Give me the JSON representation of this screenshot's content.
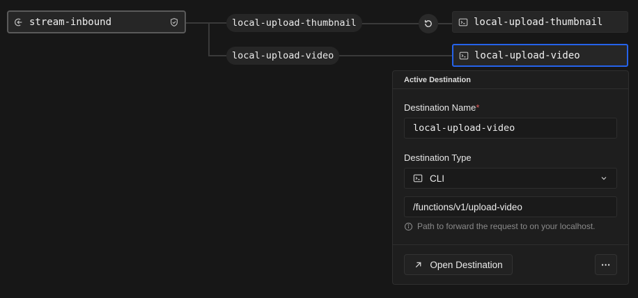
{
  "source": {
    "label": "stream-inbound",
    "icon": "inbound-icon",
    "badge_icon": "shield-check-icon"
  },
  "connections": [
    {
      "label": "local-upload-thumbnail"
    },
    {
      "label": "local-upload-video"
    }
  ],
  "retry_icon": "retry-icon",
  "destinations": [
    {
      "label": "local-upload-thumbnail",
      "icon": "terminal-icon",
      "active": false
    },
    {
      "label": "local-upload-video",
      "icon": "terminal-icon",
      "active": true
    }
  ],
  "panel": {
    "title": "Active Destination",
    "name_label": "Destination Name",
    "required_mark": "*",
    "name_value": "local-upload-video",
    "type_label": "Destination Type",
    "type_value": "CLI",
    "path_value": "/functions/v1/upload-video",
    "hint": "Path to forward the request to on your localhost.",
    "open_button": "Open Destination",
    "more_button": "···"
  },
  "colors": {
    "background": "#171717",
    "accent": "#2563eb",
    "required": "#e05a5a"
  }
}
